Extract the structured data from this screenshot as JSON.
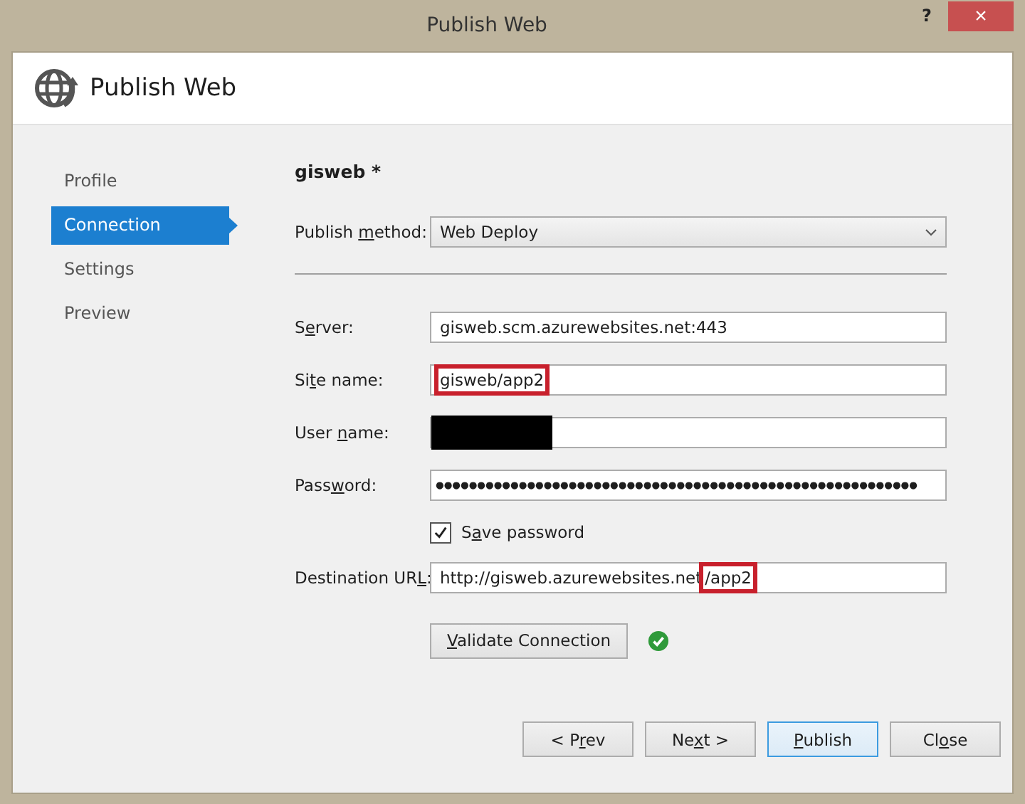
{
  "window": {
    "title": "Publish Web",
    "help": "?",
    "close": "×"
  },
  "header": {
    "title": "Publish Web"
  },
  "sidebar": {
    "items": [
      {
        "label": "Profile",
        "selected": false
      },
      {
        "label": "Connection",
        "selected": true
      },
      {
        "label": "Settings",
        "selected": false
      },
      {
        "label": "Preview",
        "selected": false
      }
    ]
  },
  "profile_name": "gisweb *",
  "publish_method": {
    "label": {
      "pre": "Publish ",
      "key": "m",
      "post": "ethod:"
    },
    "value": "Web Deploy"
  },
  "fields": [
    {
      "kind": "text",
      "label": {
        "pre": "S",
        "key": "e",
        "post": "rver:"
      },
      "value_parts": [
        {
          "text": "gisweb.scm.azurewebsites.net:443",
          "highlighted": false
        }
      ]
    },
    {
      "kind": "text",
      "label": {
        "pre": "Si",
        "key": "t",
        "post": "e name:"
      },
      "value_parts": [
        {
          "text": "gisweb/app2",
          "highlighted": true
        }
      ]
    },
    {
      "kind": "redacted",
      "label": {
        "pre": "User ",
        "key": "n",
        "post": "ame:"
      }
    },
    {
      "kind": "password",
      "label": {
        "pre": "Pass",
        "key": "w",
        "post": "ord:"
      },
      "value": "●●●●●●●●●●●●●●●●●●●●●●●●●●●●●●●●●●●●●●●●●●●●●●●●●●●●●●●●●●"
    },
    {
      "kind": "checkbox",
      "label": {
        "pre": "S",
        "key": "a",
        "post": "ve password"
      },
      "checked": true
    },
    {
      "kind": "text",
      "label": {
        "pre": "Destination UR",
        "key": "L",
        "post": ":"
      },
      "value_parts": [
        {
          "text": "http://gisweb.azurewebsites.net",
          "highlighted": false
        },
        {
          "text": "/app2",
          "highlighted": true
        }
      ]
    }
  ],
  "validate": {
    "label": {
      "key": "V",
      "post": "alidate Connection"
    },
    "success": true
  },
  "buttons": [
    {
      "label": {
        "pre": "< P",
        "key": "r",
        "post": "ev"
      },
      "default": false
    },
    {
      "label": {
        "pre": "Ne",
        "key": "x",
        "post": "t >"
      },
      "default": false
    },
    {
      "label": {
        "key": "P",
        "post": "ublish"
      },
      "default": true
    },
    {
      "label": {
        "pre": "Cl",
        "key": "o",
        "post": "se"
      },
      "default": false
    }
  ]
}
